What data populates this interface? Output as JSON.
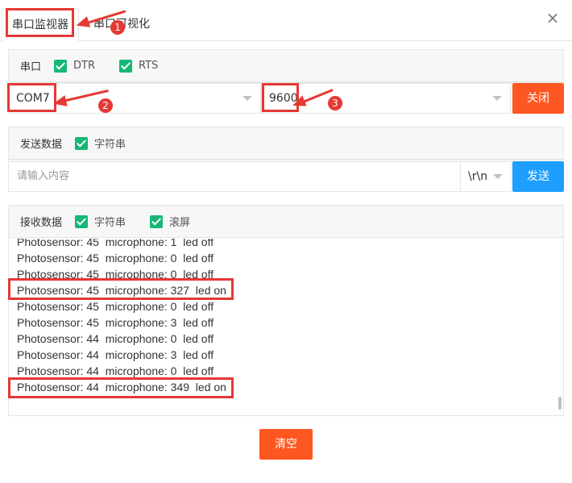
{
  "tabs": [
    {
      "label": "串口监视器",
      "active": true
    },
    {
      "label": "串口可视化",
      "active": false
    }
  ],
  "serial_panel": {
    "title": "串口",
    "dtr_label": "DTR",
    "rts_label": "RTS",
    "port_value": "COM7",
    "baud_value": "9600",
    "close_button": "关闭"
  },
  "send_panel": {
    "title": "发送数据",
    "string_label": "字符串",
    "input_placeholder": "请输入内容",
    "line_ending": "\\r\\n",
    "send_button": "发送"
  },
  "receive_panel": {
    "title": "接收数据",
    "string_label": "字符串",
    "scroll_label": "滚屏",
    "lines": [
      "Photosensor: 45  microphone: 1  led off",
      "Photosensor: 45  microphone: 0  led off",
      "Photosensor: 45  microphone: 0  led off",
      "Photosensor: 45  microphone: 327  led on",
      "Photosensor: 45  microphone: 0  led off",
      "Photosensor: 45  microphone: 3  led off",
      "Photosensor: 44  microphone: 0  led off",
      "Photosensor: 44  microphone: 3  led off",
      "Photosensor: 44  microphone: 0  led off",
      "Photosensor: 44  microphone: 349  led on"
    ]
  },
  "clear_button": "清空",
  "annotations": [
    "1",
    "2",
    "3"
  ],
  "colors": {
    "accent_orange": "#ff5722",
    "accent_blue": "#1e9fff",
    "checkbox_green": "#16b777",
    "annotation_red": "#e53935"
  }
}
